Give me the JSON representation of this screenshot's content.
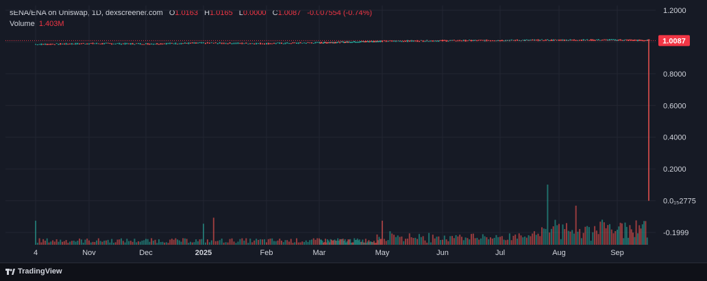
{
  "legend": {
    "symbol": "sENA/ENA on Uniswap, 1D, dexscreener.com",
    "open_label": "O",
    "open": "1.0163",
    "high_label": "H",
    "high": "1.0165",
    "low_label": "L",
    "low": "0.0000",
    "close_label": "C",
    "close": "1.0087",
    "change": "-0.007554 (-0.74%)",
    "volume_label": "Volume",
    "volume": "1.403M"
  },
  "branding": {
    "name": "TradingView"
  },
  "colors": {
    "background": "#161a25",
    "up": "#26a69a",
    "down": "#ef5350",
    "price_tag": "#f23645",
    "grid": "#232632",
    "axis_text": "#d1d4dc"
  },
  "chart_data": {
    "type": "candlestick",
    "title": "sENA/ENA on Uniswap, 1D, dexscreener.com",
    "x_tick_labels": [
      "4",
      "Nov",
      "Dec",
      "2025",
      "Feb",
      "Mar",
      "May",
      "Jun",
      "Jul",
      "Aug",
      "Sep"
    ],
    "y_tick_labels": [
      "1.2000",
      "1.0000",
      "0.8000",
      "0.6000",
      "0.4000",
      "0.2000",
      "0.0₁₅2775",
      "-0.1999"
    ],
    "y_tick_values": [
      1.2,
      1.0,
      0.8,
      0.6,
      0.4,
      0.2,
      0.0,
      -0.2
    ],
    "ylim": [
      -0.2,
      1.2
    ],
    "last_price_label": "1.0087",
    "last_price": 1.0087,
    "price_path": {
      "x": [
        "2024-10-04",
        "2024-11-01",
        "2024-12-01",
        "2025-01-01",
        "2025-02-01",
        "2025-03-01",
        "2025-05-01",
        "2025-06-01",
        "2025-07-01",
        "2025-08-01",
        "2025-09-01",
        "2025-09-21"
      ],
      "y": [
        0.985,
        0.99,
        0.988,
        0.993,
        0.99,
        0.995,
        1.005,
        1.008,
        1.01,
        1.012,
        1.013,
        1.0087
      ]
    },
    "last_candle": {
      "open": 1.0163,
      "high": 1.0165,
      "low": 0.0,
      "close": 1.0087
    },
    "volume": {
      "last": "1.403M",
      "peak_dates": [
        "2024-10-04",
        "2025-01-01",
        "2025-01-06",
        "2025-05-01",
        "2025-07-26",
        "2025-08-10"
      ],
      "relative_heights": [
        0.4,
        0.35,
        0.45,
        0.4,
        1.0,
        0.65
      ]
    },
    "grid": true,
    "legend_position": "top-left"
  }
}
